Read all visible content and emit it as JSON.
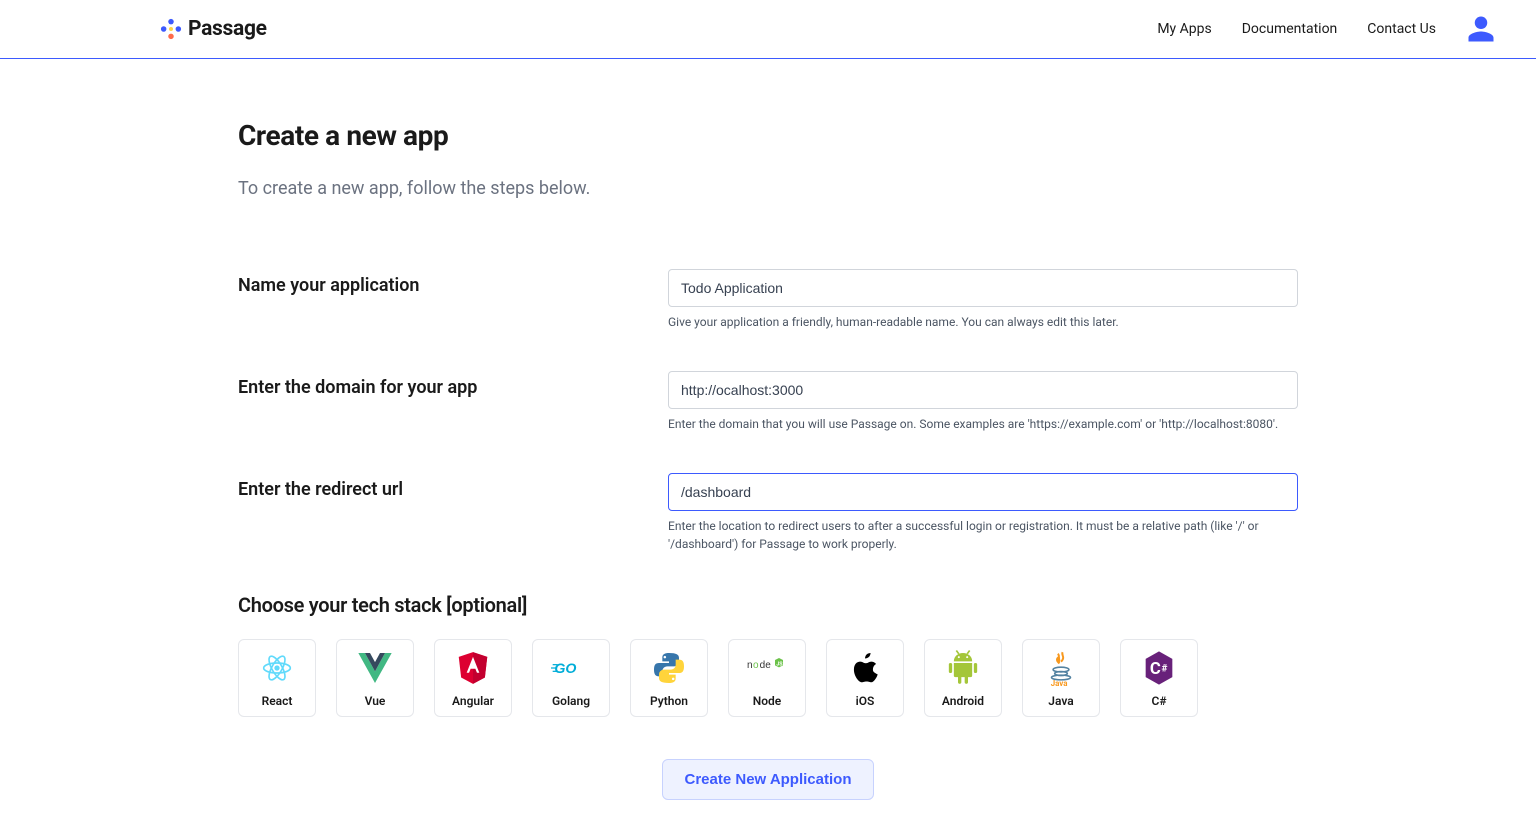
{
  "header": {
    "brand": "Passage",
    "nav": {
      "myApps": "My Apps",
      "documentation": "Documentation",
      "contactUs": "Contact Us"
    }
  },
  "page": {
    "title": "Create a new app",
    "subtitle": "To create a new app, follow the steps below."
  },
  "form": {
    "name": {
      "label": "Name your application",
      "value": "Todo Application",
      "help": "Give your application a friendly, human-readable name. You can always edit this later."
    },
    "domain": {
      "label": "Enter the domain for your app",
      "value": "http://ocalhost:3000",
      "help": "Enter the domain that you will use Passage on. Some examples are 'https://example.com' or 'http://localhost:8080'."
    },
    "redirect": {
      "label": "Enter the redirect url",
      "value": "/dashboard",
      "help": "Enter the location to redirect users to after a successful login or registration. It must be a relative path (like '/' or '/dashboard') for Passage to work properly."
    }
  },
  "techStack": {
    "title": "Choose your tech stack [optional]",
    "items": [
      {
        "id": "react",
        "label": "React"
      },
      {
        "id": "vue",
        "label": "Vue"
      },
      {
        "id": "angular",
        "label": "Angular"
      },
      {
        "id": "golang",
        "label": "Golang"
      },
      {
        "id": "python",
        "label": "Python"
      },
      {
        "id": "node",
        "label": "Node"
      },
      {
        "id": "ios",
        "label": "iOS"
      },
      {
        "id": "android",
        "label": "Android"
      },
      {
        "id": "java",
        "label": "Java"
      },
      {
        "id": "csharp",
        "label": "C#"
      }
    ]
  },
  "submit": {
    "label": "Create New Application"
  }
}
